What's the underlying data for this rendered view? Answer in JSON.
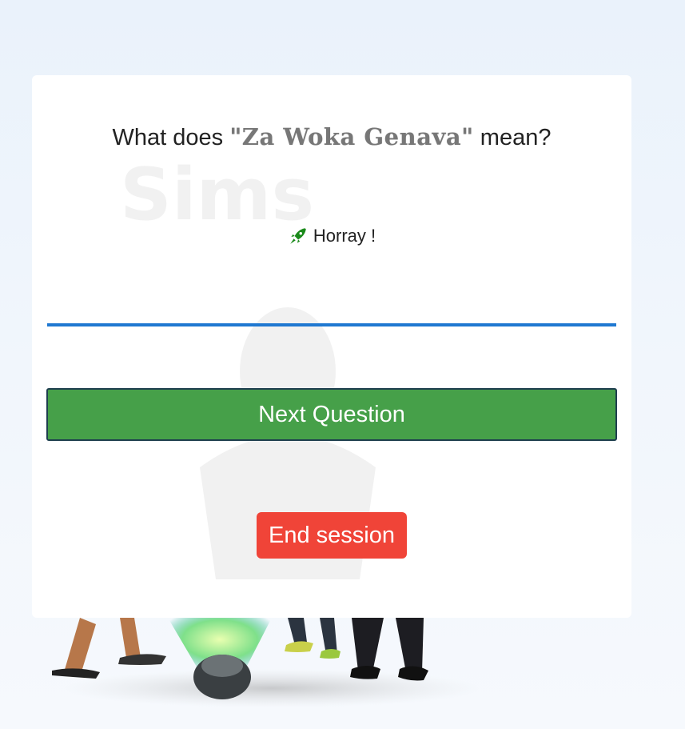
{
  "quiz": {
    "question_prefix": "What does ",
    "phrase": "\"Za Woka Genava\"",
    "question_suffix": " mean?",
    "feedback_icon": "rocket-icon",
    "feedback_text": "Horray !",
    "answer_value": "",
    "next_label": "Next Question",
    "end_label": "End session"
  },
  "colors": {
    "accent_blue": "#1f78d1",
    "next_green": "#46a049",
    "end_red": "#f04438",
    "rocket_green": "#1a8a1a"
  }
}
